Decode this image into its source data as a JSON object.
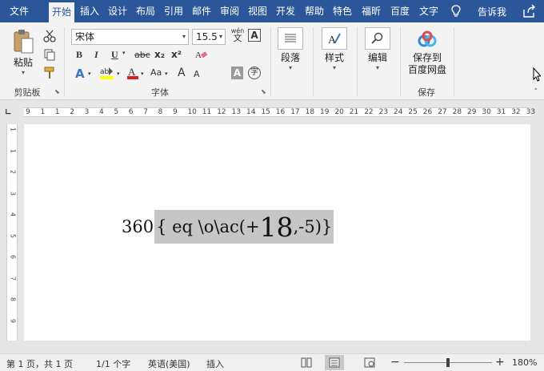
{
  "tabs": [
    "文件",
    "开始",
    "插入",
    "设计",
    "布局",
    "引用",
    "邮件",
    "审阅",
    "视图",
    "开发",
    "帮助",
    "特色",
    "福昕",
    "百度",
    "文字"
  ],
  "tell_me": "告诉我",
  "clipboard": {
    "paste": "粘贴",
    "group": "剪贴板"
  },
  "font": {
    "name": "宋体",
    "size": "15.5",
    "group": "字体",
    "wen": "wén",
    "zi": "文",
    "bold": "B",
    "italic": "I",
    "underline": "U",
    "strike": "abc",
    "sub": "x₂",
    "sup": "x²",
    "grow": "A",
    "shrink": "A",
    "aa": "Aa",
    "char_a": "A",
    "enclose": "字"
  },
  "paragraph": {
    "label": "段落"
  },
  "styles": {
    "label": "样式"
  },
  "editing": {
    "label": "编辑"
  },
  "save": {
    "label_line1": "保存到",
    "label_line2": "百度网盘",
    "group": "保存"
  },
  "ruler": {
    "h_marks": [
      "9",
      "1",
      "1",
      "2",
      "3",
      "4",
      "5",
      "6",
      "7",
      "8",
      "9",
      "10",
      "11",
      "12",
      "13",
      "14",
      "15",
      "16",
      "17",
      "18",
      "19",
      "20",
      "21",
      "22",
      "23",
      "24",
      "25",
      "26",
      "27",
      "28",
      "29",
      "30",
      "31",
      "32",
      "33"
    ],
    "v_marks": [
      "1",
      "1",
      "2",
      "3",
      "4",
      "5",
      "6",
      "7",
      "8",
      "9"
    ]
  },
  "document": {
    "prefix": "360",
    "field_open": "{ eq \\o\\ac(",
    "plus": "+",
    "eighteen": "18",
    "field_close": ",-5)}"
  },
  "status": {
    "page": "第 1 页，共 1 页",
    "words": "1/1 个字",
    "lang": "英语(美国)",
    "mode": "插入",
    "zoom": "180%"
  }
}
